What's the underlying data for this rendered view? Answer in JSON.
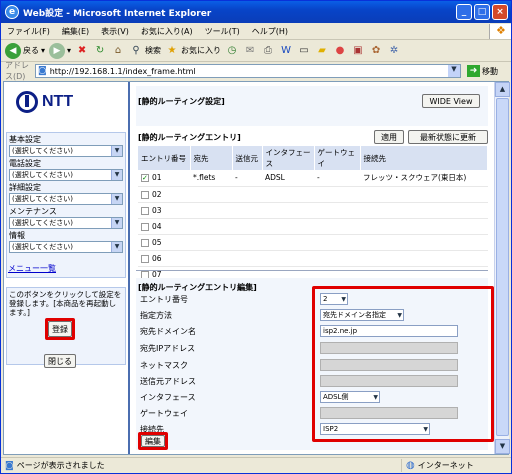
{
  "window": {
    "title": "Web設定 - Microsoft Internet Explorer"
  },
  "menubar": [
    "ファイル(F)",
    "編集(E)",
    "表示(V)",
    "お気に入り(A)",
    "ツール(T)",
    "ヘルプ(H)"
  ],
  "toolbar": {
    "back": "戻る",
    "search": "検索",
    "favorites": "お気に入り"
  },
  "address": {
    "label": "アドレス(D)",
    "url": "http://192.168.1.1/index_frame.html",
    "go": "移動"
  },
  "sidebar": {
    "logo": "NTT",
    "groups": [
      {
        "label": "基本設定",
        "value": "(選択してください)"
      },
      {
        "label": "電話設定",
        "value": "(選択してください)"
      },
      {
        "label": "詳細設定",
        "value": "(選択してください)"
      },
      {
        "label": "メンテナンス",
        "value": "(選択してください)"
      },
      {
        "label": "情報",
        "value": "(選択してください)"
      }
    ],
    "menu_link": "メニュー一覧",
    "note": "このボタンをクリックして設定を登録します。[本商品を再起動します。]",
    "register_button": "登録",
    "close_button": "閉じる"
  },
  "static_route": {
    "title": "[静的ルーティング設定]",
    "wide_view": "WIDE View"
  },
  "entries": {
    "title": "[静的ルーティングエントリ]",
    "apply_button": "適用",
    "refresh_button": "最新状態に更新",
    "headers": [
      "エントリ番号",
      "宛先",
      "送信元",
      "インタフェース",
      "ゲートウェイ",
      "接続先"
    ],
    "rows": [
      {
        "no": "01",
        "checked": true,
        "dest": "*.flets",
        "src": "-",
        "iface": "ADSL",
        "gw": "-",
        "conn": "フレッツ・スクウェア(東日本)"
      },
      {
        "no": "02",
        "checked": false,
        "dest": "",
        "src": "",
        "iface": "",
        "gw": "",
        "conn": ""
      },
      {
        "no": "03",
        "checked": false,
        "dest": "",
        "src": "",
        "iface": "",
        "gw": "",
        "conn": ""
      },
      {
        "no": "04",
        "checked": false,
        "dest": "",
        "src": "",
        "iface": "",
        "gw": "",
        "conn": ""
      },
      {
        "no": "05",
        "checked": false,
        "dest": "",
        "src": "",
        "iface": "",
        "gw": "",
        "conn": ""
      },
      {
        "no": "06",
        "checked": false,
        "dest": "",
        "src": "",
        "iface": "",
        "gw": "",
        "conn": ""
      },
      {
        "no": "07",
        "checked": false,
        "dest": "",
        "src": "",
        "iface": "",
        "gw": "",
        "conn": ""
      }
    ]
  },
  "edit": {
    "title": "[静的ルーティングエントリ編集]",
    "fields": {
      "entry_no": {
        "label": "エントリ番号",
        "value": "2"
      },
      "method": {
        "label": "指定方法",
        "value": "宛先ドメイン名指定"
      },
      "dest_domain": {
        "label": "宛先ドメイン名",
        "value": "isp2.ne.jp"
      },
      "dest_ip": {
        "label": "宛先IPアドレス",
        "value": ""
      },
      "netmask": {
        "label": "ネットマスク",
        "value": ""
      },
      "src_ip": {
        "label": "送信元アドレス",
        "value": ""
      },
      "iface": {
        "label": "インタフェース",
        "value": "ADSL側"
      },
      "gateway": {
        "label": "ゲートウェイ",
        "value": ""
      },
      "conn": {
        "label": "接続先",
        "value": "ISP2"
      }
    },
    "edit_button": "編集"
  },
  "status": {
    "text": "ページが表示されました",
    "zone": "インターネット"
  }
}
